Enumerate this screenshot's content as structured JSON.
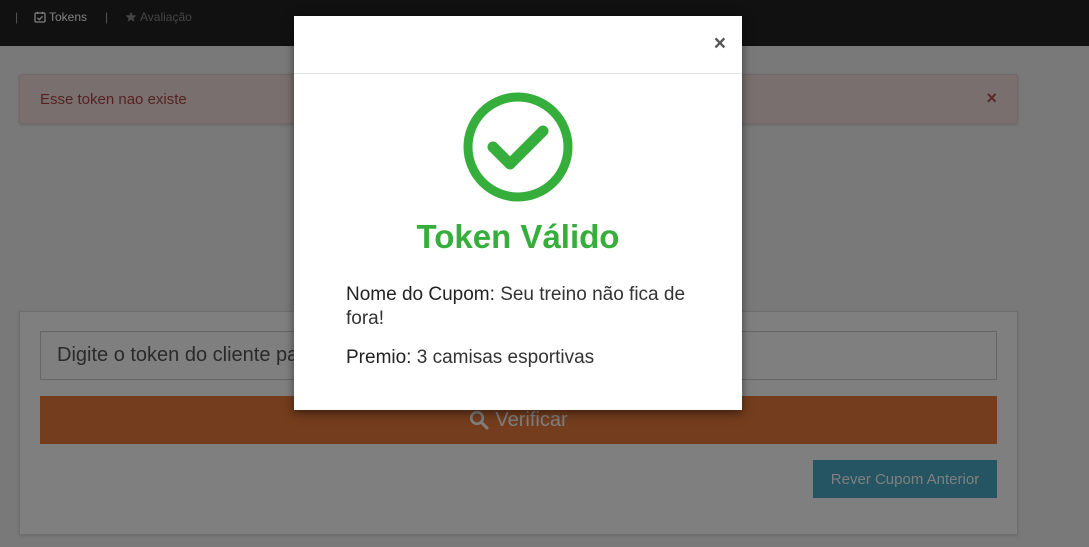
{
  "navbar": {
    "separator": "|",
    "tokens_label": "Tokens",
    "evaluation_label": "Avaliação"
  },
  "alert": {
    "message": "Esse token nao existe",
    "close": "×"
  },
  "form": {
    "token_placeholder": "Digite o token do cliente para verificar",
    "verify_label": "Verificar",
    "review_label": "Rever Cupom Anterior"
  },
  "modal": {
    "close": "×",
    "title": "Token Válido",
    "coupon_label": "Nome do Cupom:",
    "coupon_value": "Seu treino não fica de fora!",
    "prize_label": "Premio:",
    "prize_value": "3 camisas esportivas"
  },
  "colors": {
    "success": "#36ae3b",
    "verify_button": "#e97a3b",
    "review_button": "#4ba8c4",
    "alert_bg": "#f2dede",
    "navbar": "#222222"
  },
  "icons": {
    "tokens": "calendar-check-icon",
    "evaluation": "star-icon",
    "verify": "search-icon",
    "modal_status": "check-circle-icon"
  }
}
